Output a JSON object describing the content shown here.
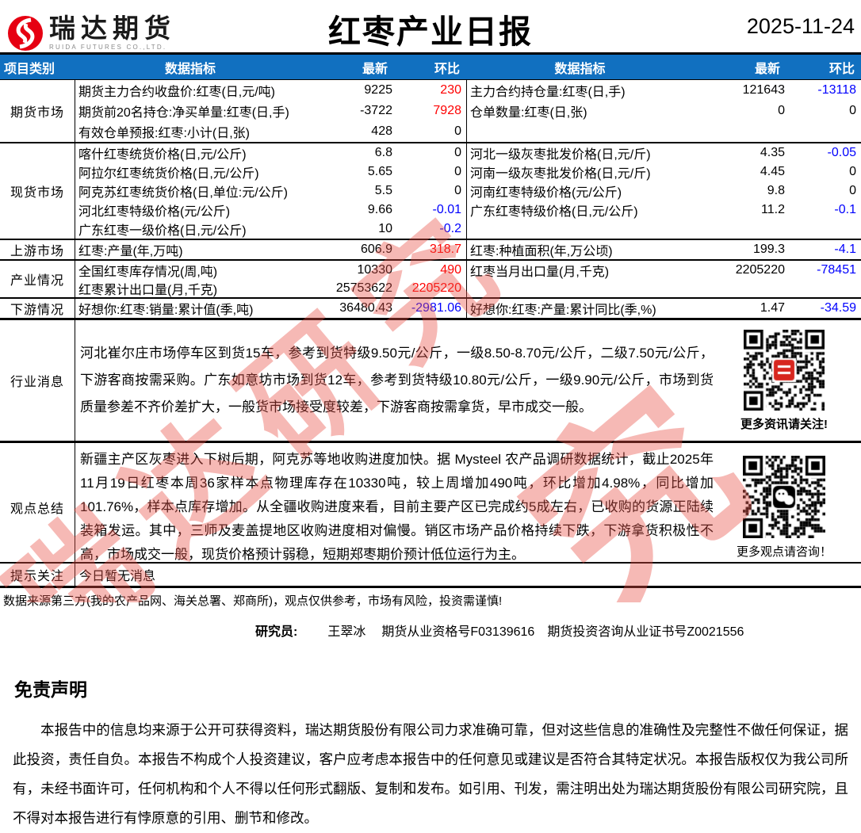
{
  "colors": {
    "header_bar": "#1170c0",
    "positive": "#fe0000",
    "negative": "#0000fe",
    "logo_red": "#e60012",
    "watermark": "#e85046"
  },
  "masthead": {
    "logo_cn": "瑞达期货",
    "logo_en": "RUIDA FUTURES CO.,LTD.",
    "title": "红枣产业日报",
    "date": "2025-11-24"
  },
  "table": {
    "headers": [
      "项目类别",
      "数据指标",
      "最新",
      "环比",
      "数据指标",
      "最新",
      "环比"
    ],
    "sections": [
      {
        "category": "期货市场",
        "rows": [
          [
            "期货主力合约收盘价:红枣(日,元/吨)",
            "9225",
            "230",
            "主力合约持仓量:红枣(日,手)",
            "121643",
            "-13118"
          ],
          [
            "期货前20名持仓:净买单量:红枣(日,手)",
            "-3722",
            "7928",
            "仓单数量:红枣(日,张)",
            "0",
            "0"
          ],
          [
            "有效仓单预报:红枣:小计(日,张)",
            "428",
            "0",
            "",
            "",
            ""
          ]
        ]
      },
      {
        "category": "现货市场",
        "rows": [
          [
            "喀什红枣统货价格(日,元/公斤)",
            "6.8",
            "0",
            "河北一级灰枣批发价格(日,元/斤)",
            "4.35",
            "-0.05"
          ],
          [
            "阿拉尔红枣统货价格(日,元/公斤)",
            "5.65",
            "0",
            "河南一级灰枣批发价格(日,元/斤)",
            "4.45",
            "0"
          ],
          [
            "阿克苏红枣统货价格(日,单位:元/公斤)",
            "5.5",
            "0",
            "河南红枣特级价格(元/公斤)",
            "9.8",
            "0"
          ],
          [
            "河北红枣特级价格(元/公斤)",
            "9.66",
            "-0.01",
            "广东红枣特级价格(日,元/公斤)",
            "11.2",
            "-0.1"
          ],
          [
            "广东红枣一级价格(日,元/公斤)",
            "10",
            "-0.2",
            "",
            "",
            ""
          ]
        ]
      },
      {
        "category": "上游市场",
        "rows": [
          [
            "红枣:产量(年,万吨)",
            "606.9",
            "318.7",
            "红枣:种植面积(年,万公顷)",
            "199.3",
            "-4.1"
          ]
        ]
      },
      {
        "category": "产业情况",
        "rows": [
          [
            "全国红枣库存情况(周,吨)",
            "10330",
            "490",
            "红枣当月出口量(月,千克)",
            "2205220",
            "-78451"
          ],
          [
            "红枣累计出口量(月,千克)",
            "25753622",
            "2205220",
            "",
            "",
            ""
          ]
        ]
      },
      {
        "category": "下游情况",
        "rows": [
          [
            "好想你:红枣:销量:累计值(季,吨)",
            "36480.43",
            "-2981.06",
            "好想你:红枣:产量:累计同比(季,%)",
            "1.47",
            "-34.59"
          ]
        ]
      }
    ],
    "news": {
      "category": "行业消息",
      "text": "河北崔尔庄市场停车区到货15车，参考到货特级9.50元/公斤，一级8.50-8.70元/公斤，二级7.50元/公斤，下游客商按需采购。广东如意坊市场到货12车，参考到货特级10.80元/公斤，一级9.90元/公斤，市场到货质量参差不齐价差扩大，一般货市场接受度较差，下游客商按需拿货，早市成交一般。",
      "qr_caption": "更多资讯请关注!"
    },
    "summary": {
      "category": "观点总结",
      "text": "新疆主产区灰枣进入下树后期，阿克苏等地收购进度加快。据 Mysteel 农产品调研数据统计，截止2025年11月19日红枣本周36家样本点物理库存在10330吨，较上周增加490吨，环比增加4.98%，同比增加101.76%，样本点库存增加。从全疆收购进度来看，目前主要产区已完成约5成左右，已收购的货源正陆续装箱发运。其中，三师及麦盖提地区收购进度相对偏慢。销区市场产品价格持续下跌，下游拿货积极性不高，市场成交一般，现货价格预计弱稳，短期郑枣期价预计低位运行为主。",
      "qr_caption": "更多观点请咨询！"
    },
    "tips": {
      "category": "提示关注",
      "text": "今日暂无消息"
    }
  },
  "footer": {
    "source_note": "数据来源第三方(我的农产品网、海关总署、郑商所)，观点仅供参考，市场有风险，投资需谨慎!",
    "researcher_label": "研究员:",
    "researcher_name": "王翠冰",
    "qualification": "期货从业资格号F03139616",
    "advisory_cert": "期货投资咨询从业证书号Z0021556"
  },
  "disclaimer": {
    "heading": "免责声明",
    "body": "本报告中的信息均来源于公开可获得资料，瑞达期货股份有限公司力求准确可靠，但对这些信息的准确性及完整性不做任何保证，据此投资，责任自负。本报告不构成个人投资建议，客户应考虑本报告中的任何意见或建议是否符合其特定状况。本报告版权仅为我公司所有，未经书面许可，任何机构和个人不得以任何形式翻版、复制和发布。如引用、刊发，需注明出处为瑞达期货股份有限公司研究院，且不得对本报告进行有悖原意的引用、删节和修改。"
  },
  "watermark": {
    "text": "瑞达研究",
    "fragment": "究"
  }
}
